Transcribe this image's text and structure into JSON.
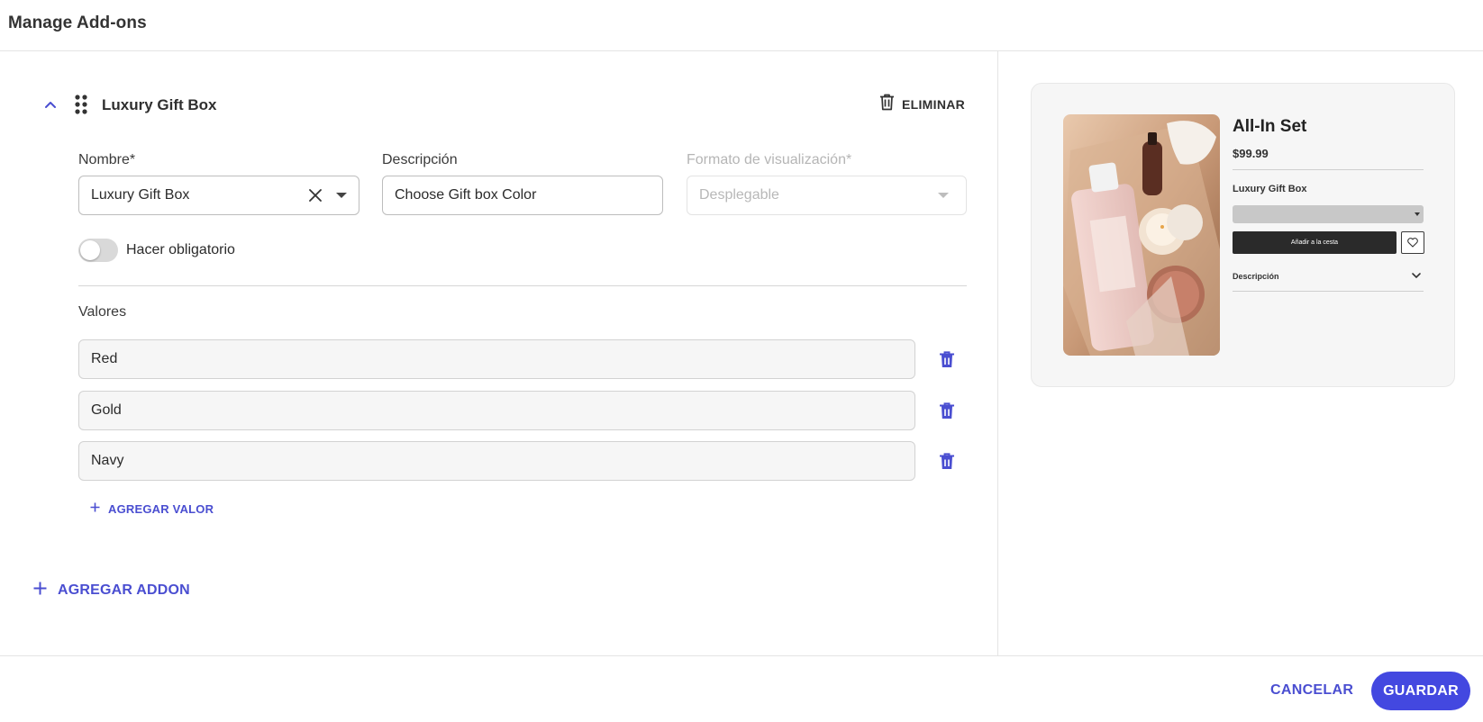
{
  "header": {
    "title": "Manage Add-ons"
  },
  "addon": {
    "name": "Luxury Gift Box",
    "delete_label": "ELIMINAR",
    "fields": {
      "name_label": "Nombre*",
      "name_value": "Luxury Gift Box",
      "description_label": "Descripción",
      "description_value": "Choose Gift box Color",
      "format_label": "Formato de visualización*",
      "format_value": "Desplegable"
    },
    "required_toggle": {
      "label": "Hacer obligatorio",
      "on": false
    },
    "values_label": "Valores",
    "values": [
      "Red",
      "Gold",
      "Navy"
    ],
    "add_value_label": "AGREGAR VALOR"
  },
  "add_addon_label": "AGREGAR ADDON",
  "preview": {
    "product_title": "All-In Set",
    "price": "$99.99",
    "addon_name": "Luxury Gift Box",
    "add_to_cart": "Añadir a la cesta",
    "description": "Descripción"
  },
  "footer": {
    "cancel_label": "CANCELAR",
    "save_label": "GUARDAR"
  },
  "colors": {
    "accent": "#4348e0",
    "link": "#4a4ed1"
  }
}
